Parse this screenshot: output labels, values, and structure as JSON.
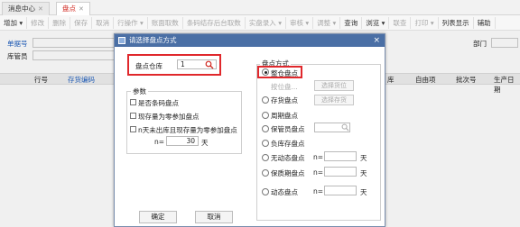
{
  "tabs": [
    {
      "label": "消息中心",
      "close": "✕"
    },
    {
      "label": "盘点",
      "close": "✕"
    }
  ],
  "toolbar": {
    "items": [
      {
        "label": "增加 ▾",
        "enabled": true
      },
      {
        "label": "修改",
        "enabled": false
      },
      {
        "label": "删除",
        "enabled": false
      },
      {
        "label": "保存",
        "enabled": false
      },
      {
        "label": "取消",
        "enabled": false
      },
      {
        "label": "行操作 ▾",
        "enabled": false
      },
      {
        "label": "账面取数",
        "enabled": false
      },
      {
        "label": "条码结存后台取数",
        "enabled": false
      },
      {
        "label": "实盘录入 ▾",
        "enabled": false
      },
      {
        "label": "审核 ▾",
        "enabled": false
      },
      {
        "label": "调整 ▾",
        "enabled": false
      },
      {
        "label": "查询",
        "enabled": true
      },
      {
        "label": "浏览 ▾",
        "enabled": true
      },
      {
        "label": "联查",
        "enabled": false
      },
      {
        "label": "打印 ▾",
        "enabled": false
      },
      {
        "label": "列表显示",
        "enabled": true
      },
      {
        "label": "辅助",
        "enabled": true
      }
    ]
  },
  "filters": {
    "doc_no_label": "单据号",
    "warehouse_keeper_label": "库管员",
    "department_label": "部门"
  },
  "grid": {
    "columns": [
      "行号",
      "存货编码",
      "库",
      "自由项",
      "批次号",
      "生产日期"
    ]
  },
  "dialog": {
    "title": "请选择盘点方式",
    "close": "×",
    "warehouse_label": "盘点仓库",
    "warehouse_value": "1",
    "params": {
      "title": "参数",
      "options": [
        {
          "label": "是否条码盘点",
          "checked": false
        },
        {
          "label": "现存量为零参加盘点",
          "checked": false
        },
        {
          "label": "n天未出库且现存量为零参加盘点",
          "checked": false
        }
      ],
      "n_label": "n=",
      "n_value": "30",
      "n_unit": "天"
    },
    "methods": {
      "title": "盘点方式",
      "whole_warehouse": "整仓盘点",
      "by_location": "按位盘...",
      "select_location": "选择货位",
      "by_inventory": "存货盘点",
      "select_inventory": "选择存货",
      "periodic": "周期盘点",
      "keeper": "保管员盘点",
      "negative": "负库存盘点",
      "no_movement": "无动态盘点",
      "shelf_life": "保质期盘点",
      "dynamic": "动态盘点",
      "n_label": "n=",
      "day_unit": "天"
    },
    "ok_button": "确定",
    "cancel_button": "取消"
  },
  "colors": {
    "highlight": "#e0282c",
    "dialog_title_bg": "#4a6fa5",
    "active_tab": "#d0261e",
    "blue_text": "#1f5fbf"
  }
}
